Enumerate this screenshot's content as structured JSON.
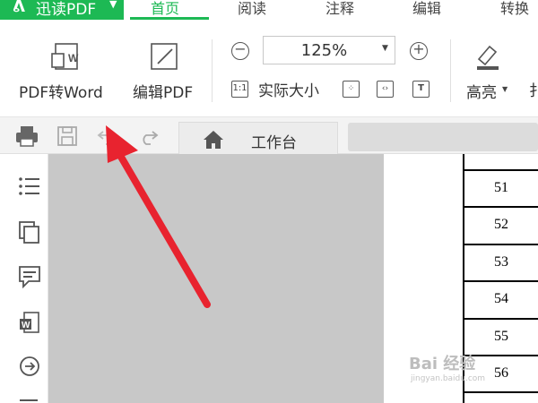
{
  "app": {
    "name": "迅读PDF",
    "brand_color": "#1db954"
  },
  "menu": {
    "tabs": [
      "首页",
      "阅读",
      "注释",
      "编辑",
      "转换"
    ],
    "active_tab": "首页"
  },
  "ribbon": {
    "pdf_to_word_label": "PDF转Word",
    "edit_pdf_label": "编辑PDF",
    "zoom_value": "125%",
    "actual_size_label": "实际大小",
    "actual_size_icon_text": "1:1",
    "highlight_label": "高亮"
  },
  "quickbar": {
    "home_tab_label": "工作台"
  },
  "document": {
    "row_numbers": [
      "51",
      "52",
      "53",
      "54",
      "55",
      "56"
    ]
  },
  "watermark": {
    "text": "Bai 经验",
    "sub": "jingyan.baidu.com"
  },
  "annotation": {
    "arrow_color": "#e8232f"
  },
  "icons": [
    "logo-icon",
    "pdf-to-word-icon",
    "edit-pdf-icon",
    "zoom-out-icon",
    "zoom-in-icon",
    "actual-size-icon",
    "fit-page-icon",
    "fit-width-icon",
    "text-select-icon",
    "highlighter-icon",
    "print-icon",
    "save-icon",
    "undo-icon",
    "redo-icon",
    "home-icon",
    "outline-icon",
    "pages-icon",
    "comment-icon",
    "word-icon",
    "convert-icon"
  ]
}
